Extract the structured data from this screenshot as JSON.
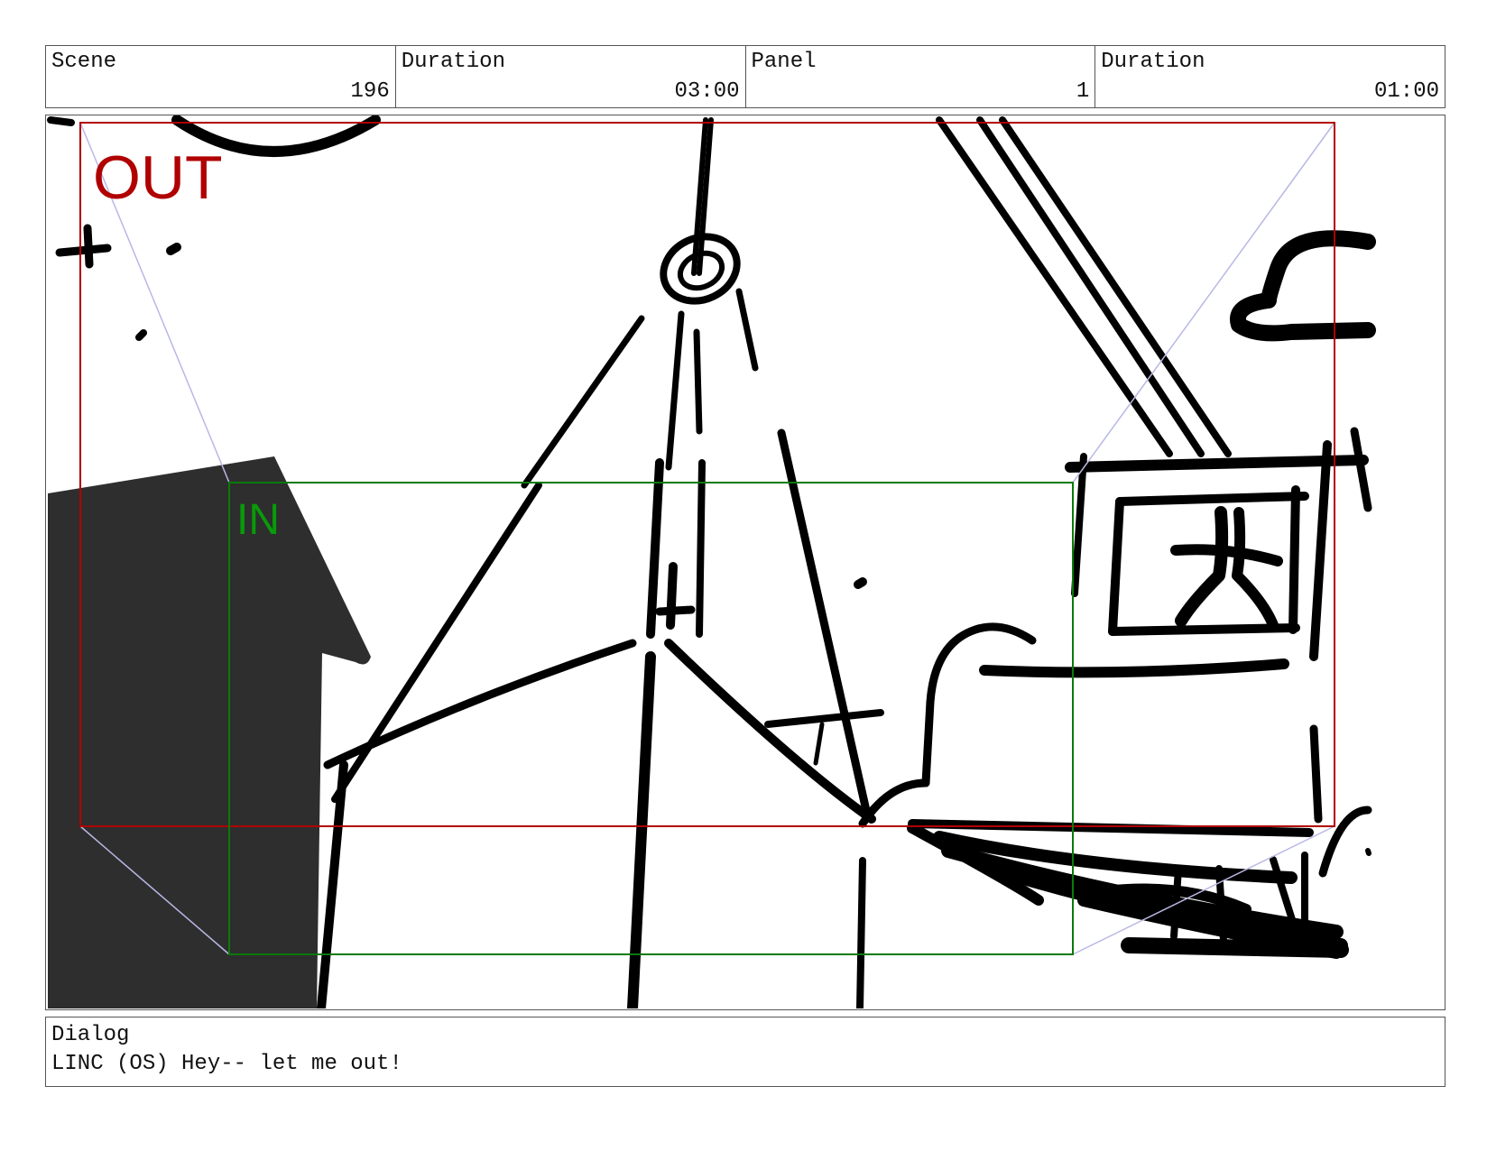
{
  "header": {
    "scene_label": "Scene",
    "scene_value": "196",
    "scene_duration_label": "Duration",
    "scene_duration_value": "03:00",
    "panel_label": "Panel",
    "panel_value": "1",
    "panel_duration_label": "Duration",
    "panel_duration_value": "01:00"
  },
  "frame": {
    "out_label": "OUT",
    "in_label": "IN",
    "out_color": "#b00000",
    "in_color": "#0a9a0a",
    "ink_color": "#000000",
    "building_color": "#2e2e2e"
  },
  "dialog": {
    "label": "Dialog",
    "text": "LINC (OS) Hey-- let me out!"
  }
}
